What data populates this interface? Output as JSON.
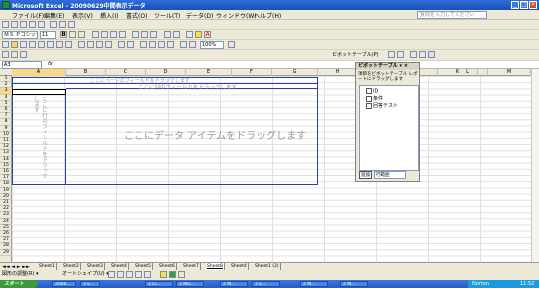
{
  "app": {
    "title": "Microsoft Excel - 20090629中間表示データ",
    "window_buttons": [
      "_",
      "□",
      "×"
    ]
  },
  "menu": {
    "items": [
      "ファイル(F)",
      "編集(E)",
      "表示(V)",
      "挿入(I)",
      "書式(O)",
      "ツール(T)",
      "データ(D)",
      "ウィンドウ(W)",
      "ヘルプ(H)"
    ],
    "help_placeholder": "質問を入力してください"
  },
  "toolbar": {
    "font_name": "ＭＳ Ｐゴシック",
    "font_size": "11",
    "zoom": "100%",
    "pivot_label": "ピボットテーブル(P)"
  },
  "formula_bar": {
    "name_box": "A3",
    "fx": "fx"
  },
  "columns": [
    "A",
    "B",
    "C",
    "D",
    "E",
    "F",
    "G",
    "H",
    "I",
    "J",
    "K",
    "L",
    "M"
  ],
  "rows": [
    "1",
    "2",
    "3",
    "4",
    "5",
    "6",
    "7",
    "8",
    "9",
    "10",
    "11",
    "12",
    "13",
    "14",
    "15",
    "16",
    "17",
    "18",
    "19",
    "20",
    "21",
    "22",
    "23",
    "24",
    "25",
    "26",
    "27",
    "28",
    "29"
  ],
  "pivot": {
    "page_hint": "ここにページのフィールドをドラッグします",
    "column_hint": "ここに列のフィールドをドラッグします",
    "row_hint": "ここに行のフィールドをドラッグします",
    "data_hint": "ここにデータ アイテムをドラッグします"
  },
  "field_pane": {
    "title": "ピボットテーブル ▾ ×",
    "instructions": "項目をピボットテーブル レポートにドラッグします",
    "fields": [
      "ID",
      "条件",
      "回答テスト"
    ],
    "add_button": "追加",
    "area_select": "行範囲"
  },
  "sheets": {
    "tabs": [
      "Sheet1",
      "Sheet2",
      "Sheet3",
      "Sheet4",
      "Sheet5",
      "Sheet6",
      "Sheet7",
      "Sheet8",
      "Sheet4",
      "Sheet1 (2)"
    ],
    "active_index": 7
  },
  "drawing": {
    "label": "図形の調整(R) ▾",
    "autoshape": "オートシェイプ(U) ▾"
  },
  "taskbar": {
    "start": "スタート",
    "tasks": [
      "2006...",
      "3 E...",
      "2 Li...",
      "2 Mic...",
      "2 M...",
      "3 E...",
      "2 M...",
      "2 M..."
    ],
    "tray_app": "Norton",
    "clock": "11:52"
  }
}
